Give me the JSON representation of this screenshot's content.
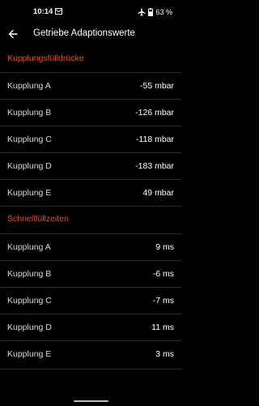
{
  "status_bar": {
    "time": "10:14",
    "battery": "63 %"
  },
  "header": {
    "title": "Getriebe Adaptionswerte"
  },
  "sections": [
    {
      "title": "Kupplungsfülldrücke",
      "rows": [
        {
          "label": "Kupplung A",
          "value": "-55 mbar"
        },
        {
          "label": "Kupplung B",
          "value": "-126 mbar"
        },
        {
          "label": "Kupplung C",
          "value": "-118 mbar"
        },
        {
          "label": "Kupplung D",
          "value": "-183 mbar"
        },
        {
          "label": "Kupplung E",
          "value": "49 mbar"
        }
      ]
    },
    {
      "title": "Schnellfüllzeiten",
      "rows": [
        {
          "label": "Kupplung A",
          "value": "9 ms"
        },
        {
          "label": "Kupplung B",
          "value": "-6 ms"
        },
        {
          "label": "Kupplung C",
          "value": "-7 ms"
        },
        {
          "label": "Kupplung D",
          "value": "11 ms"
        },
        {
          "label": "Kupplung E",
          "value": "3 ms"
        }
      ]
    }
  ],
  "colors": {
    "accent": "#e0502c",
    "background": "#000000",
    "divider": "#2a2a2a"
  },
  "icons": {
    "back": "arrow-back-icon",
    "mail": "mail-icon",
    "airplane": "airplane-icon",
    "battery": "battery-icon"
  }
}
